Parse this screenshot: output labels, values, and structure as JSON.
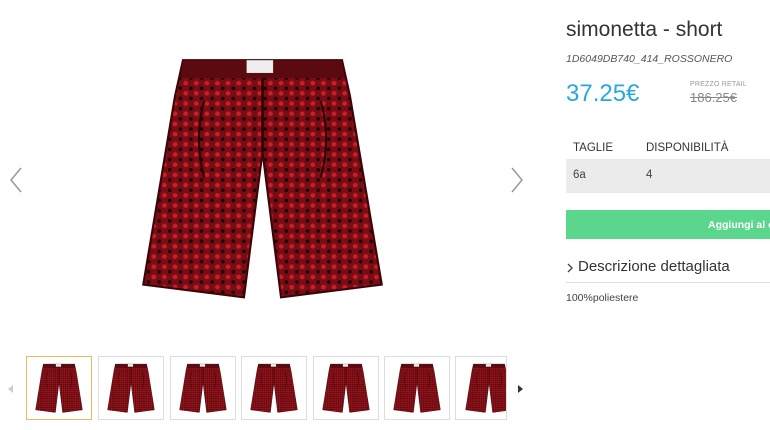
{
  "product": {
    "title": "simonetta - short",
    "sku": "1D6049DB740_414_ROSSONERO",
    "price": "37.25€",
    "retail_label": "PREZZO RETAIL",
    "retail_price": "186.25€",
    "price_color": "#29a7e1"
  },
  "sizes_table": {
    "headers": [
      "TAGLIE",
      "DISPONIBILITÀ"
    ],
    "rows": [
      [
        "6a",
        "4"
      ]
    ]
  },
  "actions": {
    "add_to_cart": "Aggiungi al c",
    "add_button_color": "#5bd68d"
  },
  "description": {
    "toggle_label": "Descrizione dettagliata",
    "material": "100%poliestere"
  },
  "gallery": {
    "thumbnail_count": 7,
    "selected_index": 0,
    "icons": {
      "prev": "chevron-left-icon",
      "next": "chevron-right-icon",
      "thumb_prev": "caret-left-icon",
      "thumb_next": "caret-right-icon"
    }
  }
}
